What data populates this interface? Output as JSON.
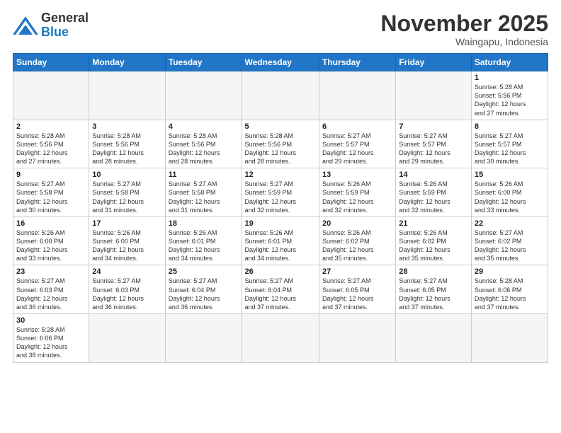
{
  "logo": {
    "line1": "General",
    "line2": "Blue"
  },
  "title": "November 2025",
  "location": "Waingapu, Indonesia",
  "weekdays": [
    "Sunday",
    "Monday",
    "Tuesday",
    "Wednesday",
    "Thursday",
    "Friday",
    "Saturday"
  ],
  "weeks": [
    [
      {
        "day": "",
        "info": ""
      },
      {
        "day": "",
        "info": ""
      },
      {
        "day": "",
        "info": ""
      },
      {
        "day": "",
        "info": ""
      },
      {
        "day": "",
        "info": ""
      },
      {
        "day": "",
        "info": ""
      },
      {
        "day": "1",
        "info": "Sunrise: 5:28 AM\nSunset: 5:56 PM\nDaylight: 12 hours\nand 27 minutes."
      }
    ],
    [
      {
        "day": "2",
        "info": "Sunrise: 5:28 AM\nSunset: 5:56 PM\nDaylight: 12 hours\nand 27 minutes."
      },
      {
        "day": "3",
        "info": "Sunrise: 5:28 AM\nSunset: 5:56 PM\nDaylight: 12 hours\nand 28 minutes."
      },
      {
        "day": "4",
        "info": "Sunrise: 5:28 AM\nSunset: 5:56 PM\nDaylight: 12 hours\nand 28 minutes."
      },
      {
        "day": "5",
        "info": "Sunrise: 5:28 AM\nSunset: 5:56 PM\nDaylight: 12 hours\nand 28 minutes."
      },
      {
        "day": "6",
        "info": "Sunrise: 5:27 AM\nSunset: 5:57 PM\nDaylight: 12 hours\nand 29 minutes."
      },
      {
        "day": "7",
        "info": "Sunrise: 5:27 AM\nSunset: 5:57 PM\nDaylight: 12 hours\nand 29 minutes."
      },
      {
        "day": "8",
        "info": "Sunrise: 5:27 AM\nSunset: 5:57 PM\nDaylight: 12 hours\nand 30 minutes."
      }
    ],
    [
      {
        "day": "9",
        "info": "Sunrise: 5:27 AM\nSunset: 5:58 PM\nDaylight: 12 hours\nand 30 minutes."
      },
      {
        "day": "10",
        "info": "Sunrise: 5:27 AM\nSunset: 5:58 PM\nDaylight: 12 hours\nand 31 minutes."
      },
      {
        "day": "11",
        "info": "Sunrise: 5:27 AM\nSunset: 5:58 PM\nDaylight: 12 hours\nand 31 minutes."
      },
      {
        "day": "12",
        "info": "Sunrise: 5:27 AM\nSunset: 5:59 PM\nDaylight: 12 hours\nand 32 minutes."
      },
      {
        "day": "13",
        "info": "Sunrise: 5:26 AM\nSunset: 5:59 PM\nDaylight: 12 hours\nand 32 minutes."
      },
      {
        "day": "14",
        "info": "Sunrise: 5:26 AM\nSunset: 5:59 PM\nDaylight: 12 hours\nand 32 minutes."
      },
      {
        "day": "15",
        "info": "Sunrise: 5:26 AM\nSunset: 6:00 PM\nDaylight: 12 hours\nand 33 minutes."
      }
    ],
    [
      {
        "day": "16",
        "info": "Sunrise: 5:26 AM\nSunset: 6:00 PM\nDaylight: 12 hours\nand 33 minutes."
      },
      {
        "day": "17",
        "info": "Sunrise: 5:26 AM\nSunset: 6:00 PM\nDaylight: 12 hours\nand 34 minutes."
      },
      {
        "day": "18",
        "info": "Sunrise: 5:26 AM\nSunset: 6:01 PM\nDaylight: 12 hours\nand 34 minutes."
      },
      {
        "day": "19",
        "info": "Sunrise: 5:26 AM\nSunset: 6:01 PM\nDaylight: 12 hours\nand 34 minutes."
      },
      {
        "day": "20",
        "info": "Sunrise: 5:26 AM\nSunset: 6:02 PM\nDaylight: 12 hours\nand 35 minutes."
      },
      {
        "day": "21",
        "info": "Sunrise: 5:26 AM\nSunset: 6:02 PM\nDaylight: 12 hours\nand 35 minutes."
      },
      {
        "day": "22",
        "info": "Sunrise: 5:27 AM\nSunset: 6:02 PM\nDaylight: 12 hours\nand 35 minutes."
      }
    ],
    [
      {
        "day": "23",
        "info": "Sunrise: 5:27 AM\nSunset: 6:03 PM\nDaylight: 12 hours\nand 36 minutes."
      },
      {
        "day": "24",
        "info": "Sunrise: 5:27 AM\nSunset: 6:03 PM\nDaylight: 12 hours\nand 36 minutes."
      },
      {
        "day": "25",
        "info": "Sunrise: 5:27 AM\nSunset: 6:04 PM\nDaylight: 12 hours\nand 36 minutes."
      },
      {
        "day": "26",
        "info": "Sunrise: 5:27 AM\nSunset: 6:04 PM\nDaylight: 12 hours\nand 37 minutes."
      },
      {
        "day": "27",
        "info": "Sunrise: 5:27 AM\nSunset: 6:05 PM\nDaylight: 12 hours\nand 37 minutes."
      },
      {
        "day": "28",
        "info": "Sunrise: 5:27 AM\nSunset: 6:05 PM\nDaylight: 12 hours\nand 37 minutes."
      },
      {
        "day": "29",
        "info": "Sunrise: 5:28 AM\nSunset: 6:06 PM\nDaylight: 12 hours\nand 37 minutes."
      }
    ],
    [
      {
        "day": "30",
        "info": "Sunrise: 5:28 AM\nSunset: 6:06 PM\nDaylight: 12 hours\nand 38 minutes."
      },
      {
        "day": "",
        "info": ""
      },
      {
        "day": "",
        "info": ""
      },
      {
        "day": "",
        "info": ""
      },
      {
        "day": "",
        "info": ""
      },
      {
        "day": "",
        "info": ""
      },
      {
        "day": "",
        "info": ""
      }
    ]
  ]
}
